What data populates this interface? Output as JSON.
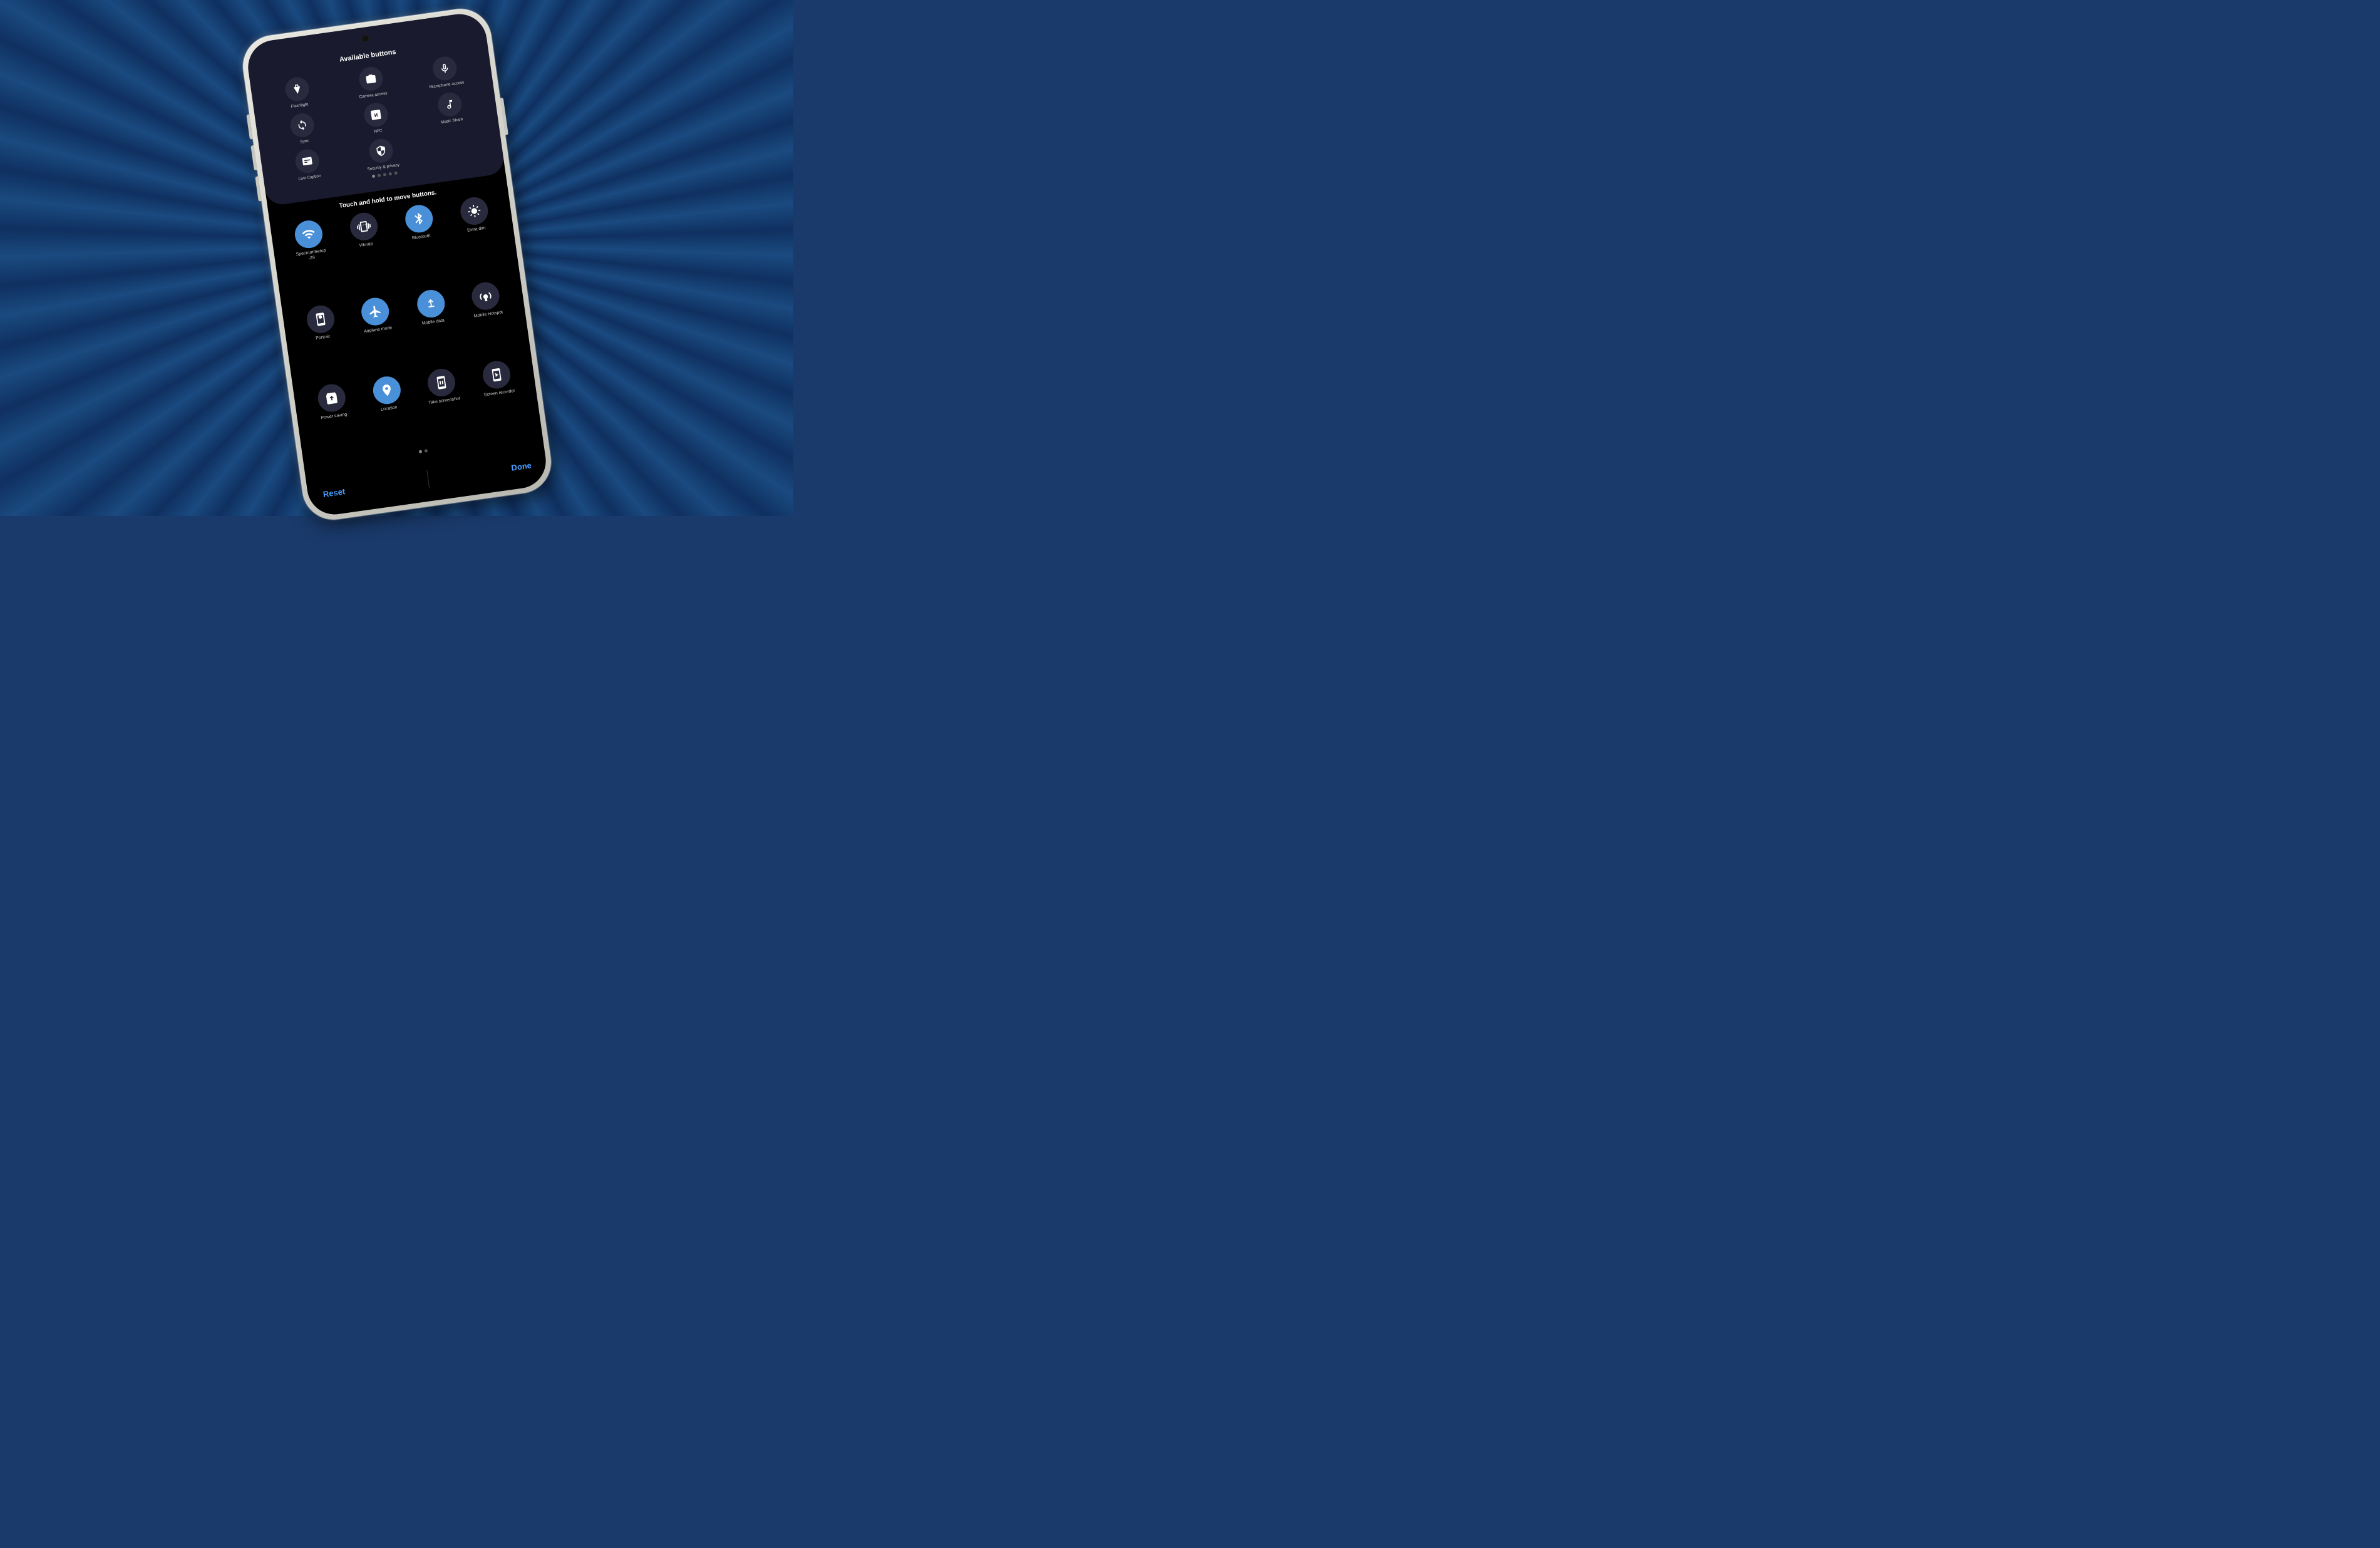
{
  "background": {
    "color": "#0d2a55"
  },
  "phone": {
    "camera_hole": "camera",
    "available_section": {
      "title": "Available buttons",
      "buttons": [
        {
          "id": "flashlight",
          "label": "Flashlight",
          "icon": "flashlight"
        },
        {
          "id": "camera-access",
          "label": "Camera access",
          "icon": "camera"
        },
        {
          "id": "microphone-access",
          "label": "Microphone access",
          "icon": "microphone"
        },
        {
          "id": "sync",
          "label": "Sync",
          "icon": "sync"
        },
        {
          "id": "nfc",
          "label": "NFC",
          "icon": "nfc"
        },
        {
          "id": "music-share",
          "label": "Music Share",
          "icon": "music"
        },
        {
          "id": "live-caption",
          "label": "Live Caption",
          "icon": "live-caption"
        },
        {
          "id": "security-privacy",
          "label": "Security & privacy",
          "icon": "security"
        }
      ],
      "dots": [
        true,
        false,
        false,
        false,
        false
      ]
    },
    "move_hint": "Touch and hold to move buttons.",
    "active_buttons": [
      {
        "id": "spectrum",
        "label": "SpectrumSetup -29",
        "icon": "wifi"
      },
      {
        "id": "vibrate",
        "label": "Vibrate",
        "icon": "vibrate"
      },
      {
        "id": "bluetooth",
        "label": "Bluetooth",
        "icon": "bluetooth"
      },
      {
        "id": "extra-dim",
        "label": "Extra dim",
        "icon": "extra-dim"
      },
      {
        "id": "portrait",
        "label": "Portrait",
        "icon": "portrait"
      },
      {
        "id": "airplane",
        "label": "Airplane mode",
        "icon": "airplane"
      },
      {
        "id": "mobile-data",
        "label": "Mobile data",
        "icon": "mobile-data"
      },
      {
        "id": "mobile-hotspot",
        "label": "Mobile Hotspot",
        "icon": "hotspot"
      },
      {
        "id": "power-saving",
        "label": "Power saving",
        "icon": "power"
      },
      {
        "id": "location",
        "label": "Location",
        "icon": "location"
      },
      {
        "id": "screenshot",
        "label": "Take screenshot",
        "icon": "screenshot"
      },
      {
        "id": "screen-recorder",
        "label": "Screen recorder",
        "icon": "screen-recorder"
      }
    ],
    "dots2": [
      true,
      false
    ],
    "reset_label": "Reset",
    "done_label": "Done"
  }
}
